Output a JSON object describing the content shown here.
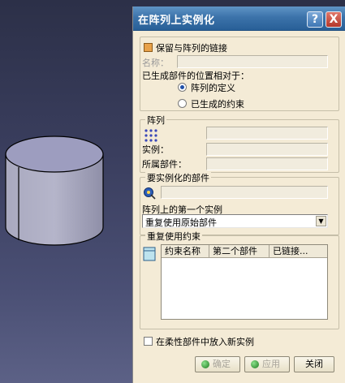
{
  "dialog": {
    "title": "在阵列上实例化",
    "help_label": "?",
    "close_label": "X"
  },
  "keep_link": {
    "label": "保留与阵列的链接",
    "checked": true
  },
  "name_field": {
    "label": "名称：",
    "value": ""
  },
  "position_group": {
    "label": "已生成部件的位置相对于：",
    "options": [
      {
        "label": "阵列的定义",
        "selected": true
      },
      {
        "label": "已生成的约束",
        "selected": false
      }
    ]
  },
  "pattern_group": {
    "title": "阵列",
    "instance_label": "实例：",
    "owner_label": "所属部件："
  },
  "component_group": {
    "title": "要实例化的部件",
    "first_instance_label": "阵列上的第一个实例",
    "first_instance_value": "重复使用原始部件"
  },
  "constraint_group": {
    "title": "重复使用约束",
    "columns": [
      "约束名称",
      "第二个部件",
      "已链接..."
    ]
  },
  "flexible": {
    "label": "在柔性部件中放入新实例",
    "checked": false
  },
  "buttons": {
    "ok": "确定",
    "apply": "应用",
    "close": "关闭"
  }
}
